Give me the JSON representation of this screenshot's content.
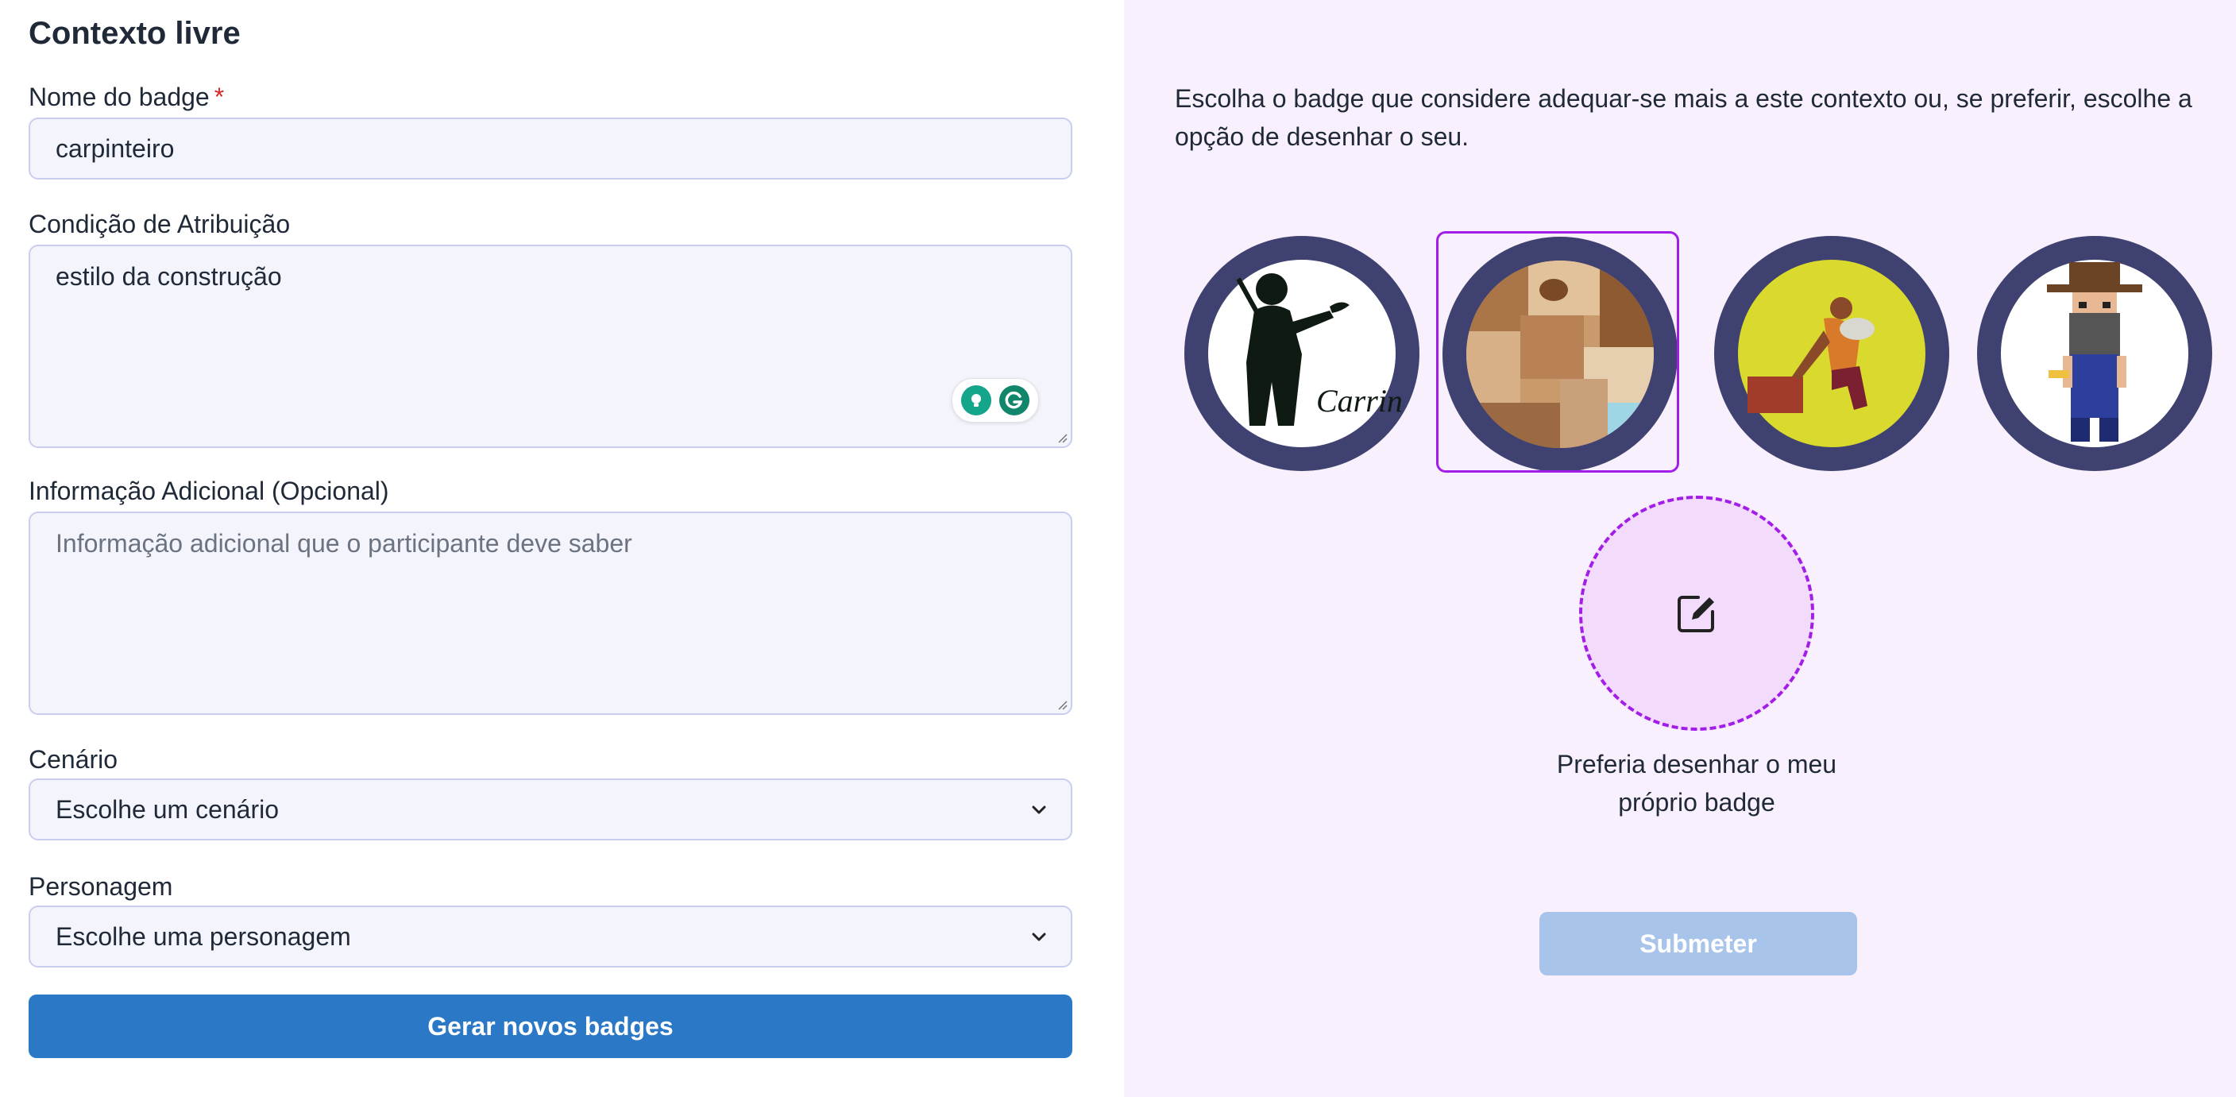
{
  "form": {
    "title": "Contexto livre",
    "badge_name": {
      "label": "Nome do badge",
      "required_mark": "*",
      "value": "carpinteiro"
    },
    "condition": {
      "label": "Condição de Atribuição",
      "value": "estilo da construção"
    },
    "extra_info": {
      "label": "Informação Adicional (Opcional)",
      "placeholder": "Informação adicional que o participante deve saber"
    },
    "scenario": {
      "label": "Cenário",
      "selected": "Escolhe um cenário"
    },
    "character": {
      "label": "Personagem",
      "selected": "Escolhe uma personagem"
    },
    "generate_button": "Gerar novos badges"
  },
  "picker": {
    "instructions": "Escolha o badge que considere adequar-se mais a este contexto ou, se preferir, escolhe a opção de desenhar o seu.",
    "badges": [
      {
        "name": "silhouette-carpenter",
        "logo_text": "Carrin",
        "selected": false
      },
      {
        "name": "wood-blocks",
        "selected": true
      },
      {
        "name": "crouching-worker",
        "selected": false
      },
      {
        "name": "pixel-lumberjack",
        "selected": false
      }
    ],
    "draw_option_label": "Preferia desenhar o meu próprio badge",
    "submit_button": "Submeter"
  },
  "colors": {
    "primary": "#2b78c6",
    "selection": "#a21ee8",
    "badge_ring": "#3f4270",
    "submit_disabled": "#a9c4ea",
    "panel_bg": "#f9f0fd"
  }
}
